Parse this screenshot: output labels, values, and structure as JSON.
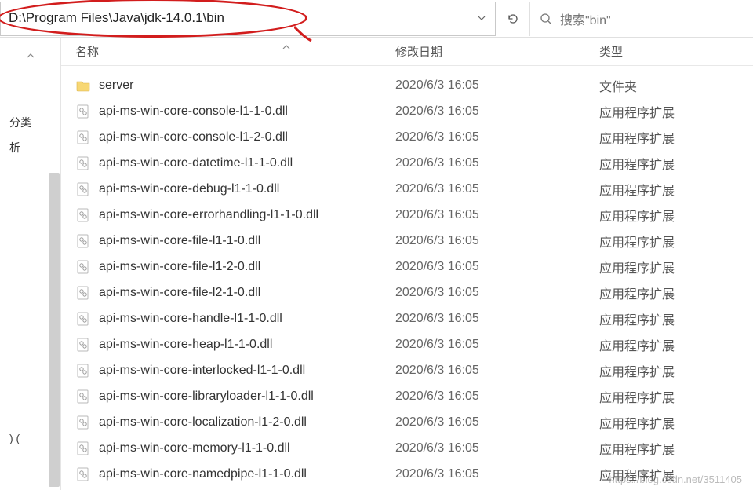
{
  "address": "D:\\Program Files\\Java\\jdk-14.0.1\\bin",
  "search_placeholder": "搜索\"bin\"",
  "columns": {
    "name": "名称",
    "date": "修改日期",
    "type": "类型"
  },
  "nav": {
    "items": [
      "分类",
      "析"
    ],
    "bottom": ") ("
  },
  "type_labels": {
    "folder": "文件夹",
    "dll": "应用程序扩展"
  },
  "files": [
    {
      "kind": "folder",
      "name": "server",
      "date": "2020/6/3 16:05"
    },
    {
      "kind": "dll",
      "name": "api-ms-win-core-console-l1-1-0.dll",
      "date": "2020/6/3 16:05"
    },
    {
      "kind": "dll",
      "name": "api-ms-win-core-console-l1-2-0.dll",
      "date": "2020/6/3 16:05"
    },
    {
      "kind": "dll",
      "name": "api-ms-win-core-datetime-l1-1-0.dll",
      "date": "2020/6/3 16:05"
    },
    {
      "kind": "dll",
      "name": "api-ms-win-core-debug-l1-1-0.dll",
      "date": "2020/6/3 16:05"
    },
    {
      "kind": "dll",
      "name": "api-ms-win-core-errorhandling-l1-1-0.dll",
      "date": "2020/6/3 16:05"
    },
    {
      "kind": "dll",
      "name": "api-ms-win-core-file-l1-1-0.dll",
      "date": "2020/6/3 16:05"
    },
    {
      "kind": "dll",
      "name": "api-ms-win-core-file-l1-2-0.dll",
      "date": "2020/6/3 16:05"
    },
    {
      "kind": "dll",
      "name": "api-ms-win-core-file-l2-1-0.dll",
      "date": "2020/6/3 16:05"
    },
    {
      "kind": "dll",
      "name": "api-ms-win-core-handle-l1-1-0.dll",
      "date": "2020/6/3 16:05"
    },
    {
      "kind": "dll",
      "name": "api-ms-win-core-heap-l1-1-0.dll",
      "date": "2020/6/3 16:05"
    },
    {
      "kind": "dll",
      "name": "api-ms-win-core-interlocked-l1-1-0.dll",
      "date": "2020/6/3 16:05"
    },
    {
      "kind": "dll",
      "name": "api-ms-win-core-libraryloader-l1-1-0.dll",
      "date": "2020/6/3 16:05"
    },
    {
      "kind": "dll",
      "name": "api-ms-win-core-localization-l1-2-0.dll",
      "date": "2020/6/3 16:05"
    },
    {
      "kind": "dll",
      "name": "api-ms-win-core-memory-l1-1-0.dll",
      "date": "2020/6/3 16:05"
    },
    {
      "kind": "dll",
      "name": "api-ms-win-core-namedpipe-l1-1-0.dll",
      "date": "2020/6/3 16:05"
    }
  ],
  "watermark": "https://blog.csdn.net/3511405"
}
